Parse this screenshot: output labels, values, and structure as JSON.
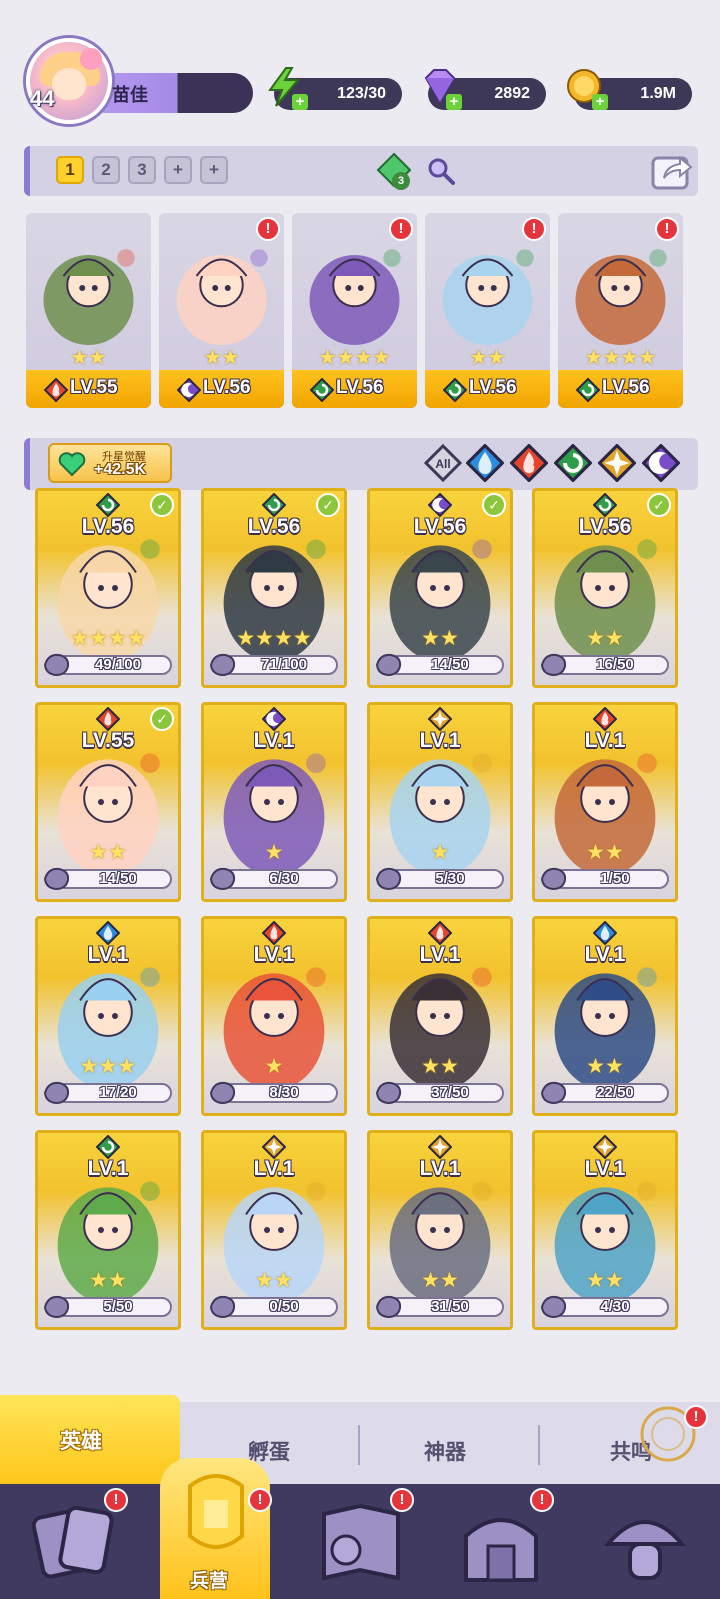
{
  "player": {
    "level": "44",
    "name": "苗佳"
  },
  "resources": [
    {
      "name": "energy",
      "icon": "lightning-icon",
      "value": "123/30",
      "color": "#6bd23a"
    },
    {
      "name": "gems",
      "icon": "diamond-icon",
      "value": "2892",
      "color": "#a27ae8"
    },
    {
      "name": "gold",
      "icon": "coin-icon",
      "value": "1.9M",
      "color": "#f6b62a"
    }
  ],
  "team_bar": {
    "slots": [
      "1",
      "2",
      "3",
      "+",
      "+"
    ],
    "active_slot": "1",
    "gem_badge": "3"
  },
  "team": [
    {
      "level": "LV.55",
      "element": "fire",
      "stars": "★★"
    },
    {
      "level": "LV.56",
      "element": "dark",
      "stars": "★★"
    },
    {
      "level": "LV.56",
      "element": "wind",
      "stars": "★★★★"
    },
    {
      "level": "LV.56",
      "element": "wind",
      "stars": "★★"
    },
    {
      "level": "LV.56",
      "element": "wind",
      "stars": "★★★★"
    }
  ],
  "filter": {
    "awaken_label": "升星觉醒",
    "awaken_value": "+42.5K",
    "all_label": "All",
    "elements": [
      "water",
      "fire",
      "wind",
      "light",
      "dark"
    ]
  },
  "heroes": [
    {
      "level": "LV.56",
      "element": "wind",
      "shards": "49/100",
      "stars": "★★★★",
      "checked": true
    },
    {
      "level": "LV.56",
      "element": "wind",
      "shards": "71/100",
      "stars": "★★★★",
      "checked": true
    },
    {
      "level": "LV.56",
      "element": "dark",
      "shards": "14/50",
      "stars": "★★",
      "checked": true
    },
    {
      "level": "LV.56",
      "element": "wind",
      "shards": "16/50",
      "stars": "★★",
      "checked": true
    },
    {
      "level": "LV.55",
      "element": "fire",
      "shards": "14/50",
      "stars": "★★",
      "checked": true
    },
    {
      "level": "LV.1",
      "element": "dark",
      "shards": "6/30",
      "stars": "★",
      "checked": false
    },
    {
      "level": "LV.1",
      "element": "light",
      "shards": "5/30",
      "stars": "★",
      "checked": false
    },
    {
      "level": "LV.1",
      "element": "fire",
      "shards": "1/50",
      "stars": "★★",
      "checked": false
    },
    {
      "level": "LV.1",
      "element": "water",
      "shards": "17/20",
      "stars": "★★★",
      "checked": false
    },
    {
      "level": "LV.1",
      "element": "fire",
      "shards": "8/30",
      "stars": "★",
      "checked": false
    },
    {
      "level": "LV.1",
      "element": "fire",
      "shards": "37/50",
      "stars": "★★",
      "checked": false
    },
    {
      "level": "LV.1",
      "element": "water",
      "shards": "22/50",
      "stars": "★★",
      "checked": false
    },
    {
      "level": "LV.1",
      "element": "wind",
      "shards": "5/50",
      "stars": "★★",
      "checked": false
    },
    {
      "level": "LV.1",
      "element": "light",
      "shards": "0/50",
      "stars": "★★",
      "checked": false
    },
    {
      "level": "LV.1",
      "element": "light",
      "shards": "31/50",
      "stars": "★★",
      "checked": false
    },
    {
      "level": "LV.1",
      "element": "light",
      "shards": "4/30",
      "stars": "★★",
      "checked": false
    }
  ],
  "sub_tabs": {
    "heroes": "英雄",
    "eggs": "孵蛋",
    "artifacts": "神器",
    "resonance": "共鸣"
  },
  "nav": {
    "barracks": "兵营"
  },
  "colors": {
    "fire": "#e4452b",
    "water": "#2a8ee0",
    "wind": "#2f9e4a",
    "light": "#e0a52a",
    "dark": "#7a4cc8",
    "gold": "#ffc21d",
    "alert": "#e6343c"
  }
}
